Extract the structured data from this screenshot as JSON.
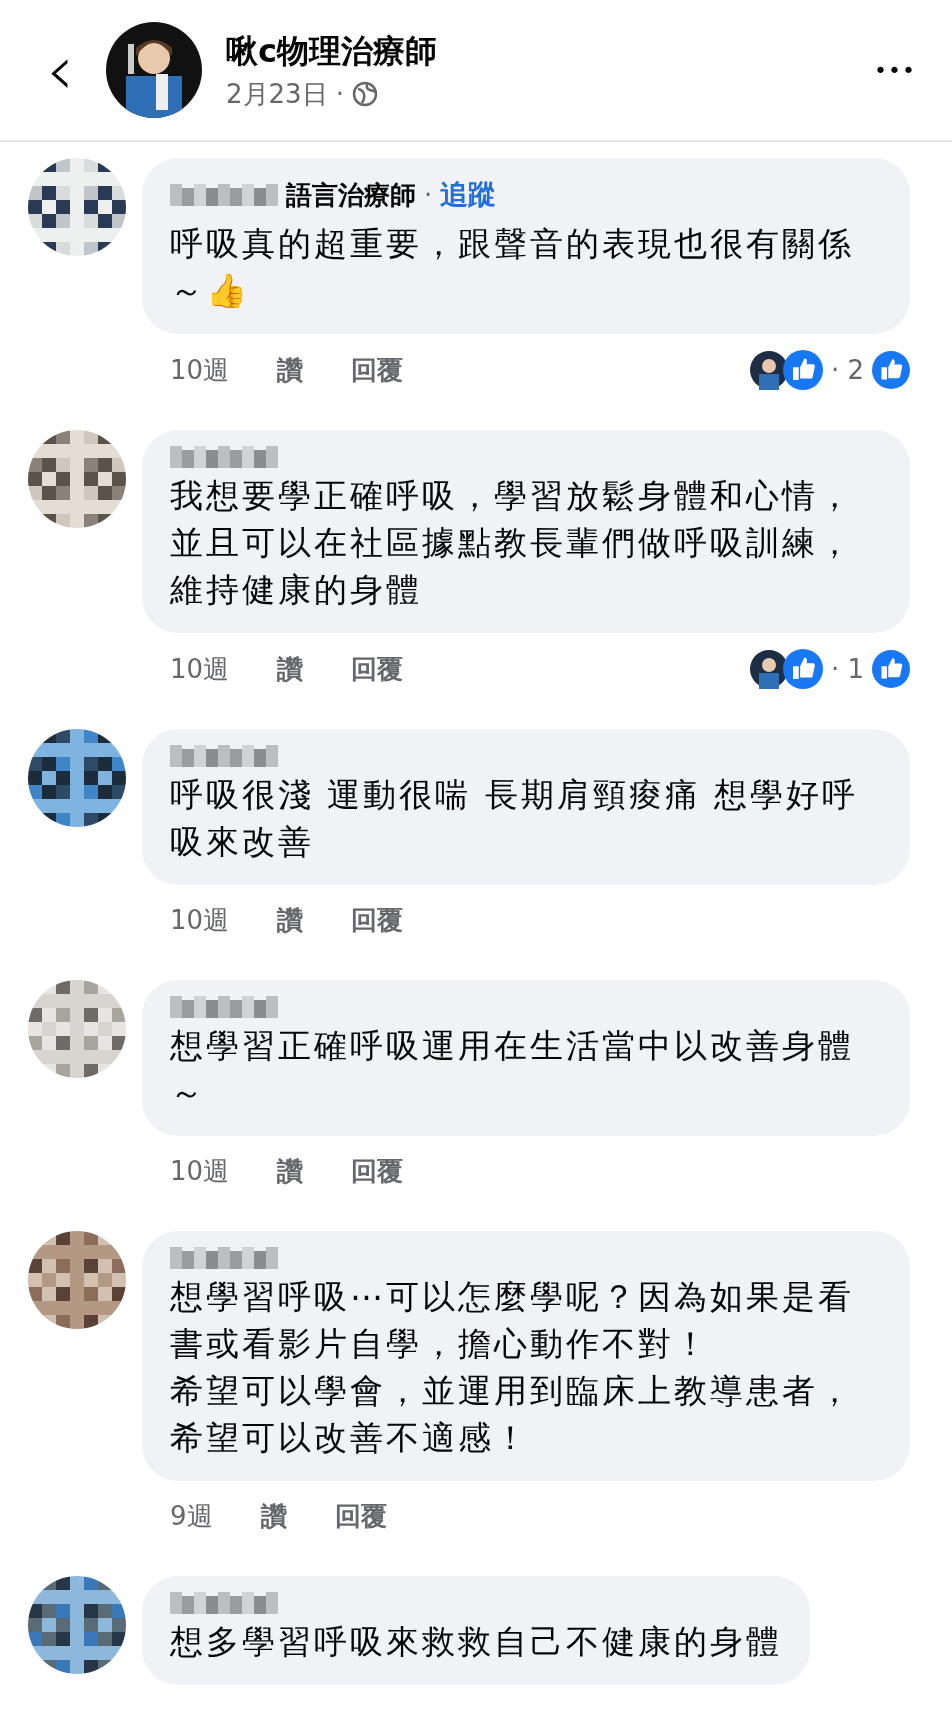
{
  "header": {
    "back": "‹",
    "title": "啾c物理治療師",
    "date": "2月23日",
    "separator": "·",
    "more": "•••"
  },
  "comments": [
    {
      "author_suffix": "語言治療師",
      "separator": "·",
      "follow": "追蹤",
      "text": "呼吸真的超重要，跟聲音的表現也很有關係～👍",
      "time": "10週",
      "like": "讚",
      "reply": "回覆",
      "reactions": "· 2"
    },
    {
      "text": "我想要學正確呼吸，學習放鬆身體和心情，並且可以在社區據點教長輩們做呼吸訓練，維持健康的身體",
      "time": "10週",
      "like": "讚",
      "reply": "回覆",
      "reactions": "· 1"
    },
    {
      "text": "呼吸很淺 運動很喘 長期肩頸痠痛 想學好呼吸來改善",
      "time": "10週",
      "like": "讚",
      "reply": "回覆"
    },
    {
      "text": "想學習正確呼吸運用在生活當中以改善身體～",
      "time": "10週",
      "like": "讚",
      "reply": "回覆"
    },
    {
      "text": "想學習呼吸⋯可以怎麼學呢？因為如果是看書或看影片自學，擔心動作不對！",
      "text_2": "希望可以學會，並運用到臨床上教導患者，希望可以改善不適感！",
      "time": "9週",
      "like": "讚",
      "reply": "回覆"
    },
    {
      "text": "想多學習呼吸來救救自己不健康的身體"
    }
  ]
}
